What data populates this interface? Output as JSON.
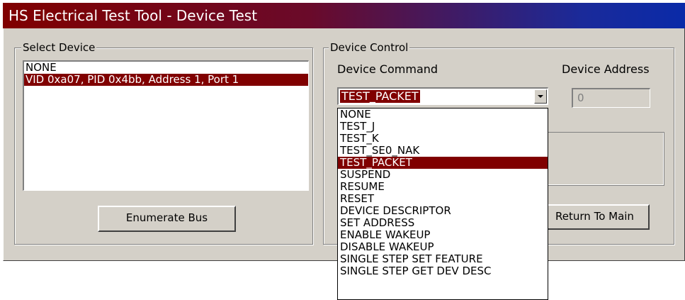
{
  "window": {
    "title": "HS Electrical Test Tool - Device Test"
  },
  "select_device": {
    "legend": "Select Device",
    "items": [
      {
        "label": "NONE",
        "selected": false
      },
      {
        "label": "VID 0xa07, PID 0x4bb, Address 1, Port 1",
        "selected": true
      }
    ],
    "enumerate_label": "Enumerate Bus"
  },
  "device_control": {
    "legend": "Device Control",
    "command_label": "Device Command",
    "address_label": "Device Address",
    "address_value": "0",
    "command_value": "TEST_PACKET",
    "command_options": [
      {
        "label": "NONE",
        "selected": false
      },
      {
        "label": "TEST_J",
        "selected": false
      },
      {
        "label": "TEST_K",
        "selected": false
      },
      {
        "label": "TEST_SE0_NAK",
        "selected": false
      },
      {
        "label": "TEST_PACKET",
        "selected": true
      },
      {
        "label": "SUSPEND",
        "selected": false
      },
      {
        "label": "RESUME",
        "selected": false
      },
      {
        "label": "RESET",
        "selected": false
      },
      {
        "label": "DEVICE DESCRIPTOR",
        "selected": false
      },
      {
        "label": "SET ADDRESS",
        "selected": false
      },
      {
        "label": "ENABLE WAKEUP",
        "selected": false
      },
      {
        "label": "DISABLE WAKEUP",
        "selected": false
      },
      {
        "label": "SINGLE STEP SET FEATURE",
        "selected": false
      },
      {
        "label": "SINGLE STEP GET DEV DESC",
        "selected": false
      }
    ],
    "return_label": "Return To Main"
  },
  "colors": {
    "selection": "#800000",
    "face": "#d4d0c8",
    "title_gradient_start": "#800000",
    "title_gradient_end": "#0a2aa8"
  }
}
